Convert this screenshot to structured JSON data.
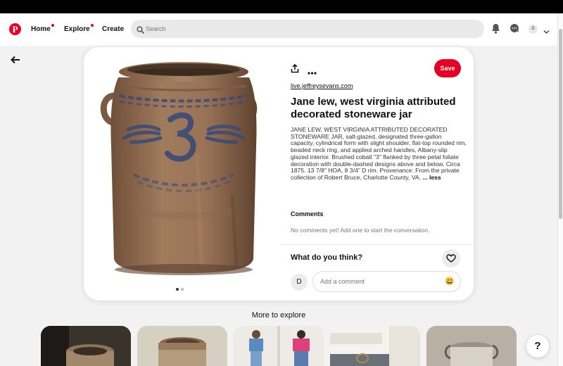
{
  "header": {
    "logo_glyph": "P",
    "nav": [
      {
        "label": "Home",
        "has_dot": true
      },
      {
        "label": "Explore",
        "has_dot": true
      },
      {
        "label": "Create",
        "has_dot": false
      }
    ],
    "search_placeholder": "Search",
    "avatar_initial": "D",
    "icons": [
      "bell-icon",
      "chat-icon",
      "chevron-down-icon"
    ]
  },
  "pin": {
    "source": "live.jeffreysevans.com",
    "title": "Jane lew, west virginia attributed decorated stoneware jar",
    "description": "JANE LEW, WEST VIRGINIA ATTRIBUTED DECORATED STONEWARE JAR, salt-glazed, designated three-gallon capacity, cylindrical form with slight shoulder, flat-top rounded rim, beaded neck ring, and applied arched handles, Albany-slip glazed interior. Brushed cobalt \"3\" flanked by three petal foliate decoration with double-dashed designs above and below. Circa 1875. 13 7/8\" HOA, 8 3/4\" D rim. Provenance: From the private collection of Robert Bruce, Charlotte County, VA.",
    "less_label": "... less",
    "save_label": "Save",
    "image_number": "3",
    "carousel_pages": 2,
    "carousel_active": 1
  },
  "comments": {
    "heading": "Comments",
    "empty_text": "No comments yet! Add one to start the conversation.",
    "prompt": "What do you think?",
    "avatar_initial": "D",
    "input_placeholder": "Add a comment",
    "emoji": "😃"
  },
  "explore": {
    "heading": "More to explore",
    "thumbs": [
      {
        "name": "explore-thumb-dark-crock"
      },
      {
        "name": "explore-thumb-brown-crock"
      },
      {
        "name": "explore-thumb-fashion"
      },
      {
        "name": "explore-thumb-kitchen"
      },
      {
        "name": "explore-thumb-white-jar"
      }
    ]
  },
  "help_label": "?",
  "colors": {
    "accent": "#e60023",
    "jar_body": "#9a7356",
    "cobalt": "#3a4a78"
  }
}
